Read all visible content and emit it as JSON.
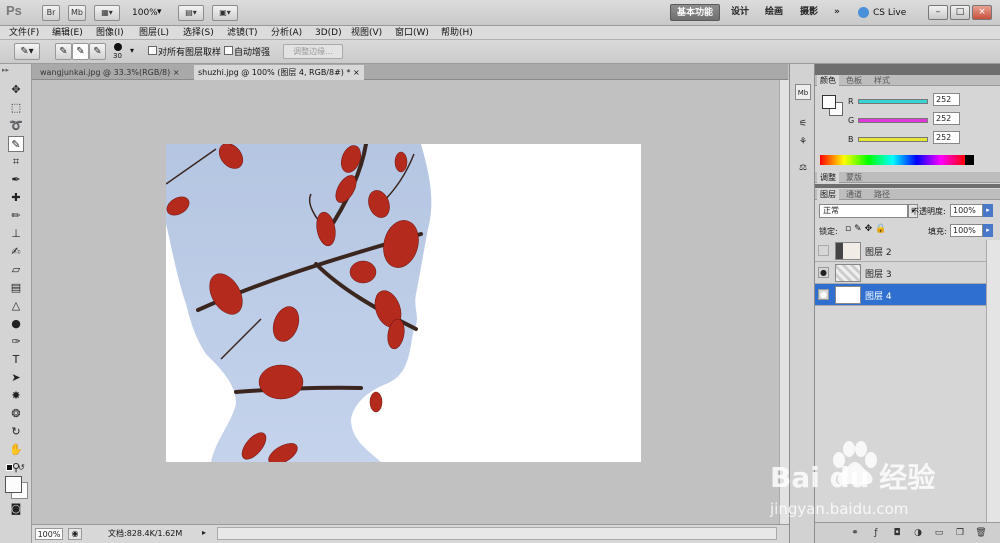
{
  "appbar": {
    "logo": "Ps",
    "app_icons": [
      "Br",
      "Mb"
    ],
    "zoom": "100%",
    "workspaces": [
      "基本功能",
      "设计",
      "绘画",
      "摄影"
    ],
    "more": "»",
    "cslive": "CS Live",
    "window_buttons": [
      "–",
      "□",
      "×"
    ]
  },
  "menu": [
    "文件(F)",
    "编辑(E)",
    "图像(I)",
    "图层(L)",
    "选择(S)",
    "滤镜(T)",
    "分析(A)",
    "3D(D)",
    "视图(V)",
    "窗口(W)",
    "帮助(H)"
  ],
  "options": {
    "brush_size": "30",
    "sample_all_layers": "对所有图层取样",
    "auto_enhance": "自动增强",
    "refine_edge": "调整边缘..."
  },
  "doc_tabs": [
    {
      "label": "wangjunkai.jpg @ 33.3%(RGB/8)",
      "close": "×"
    },
    {
      "label": "shuzhi.jpg @ 100% (图层 4, RGB/8#) *",
      "close": "×"
    }
  ],
  "status": {
    "zoom": "100%",
    "doc_info": "文档:828.4K/1.62M"
  },
  "color_panel": {
    "tabs": [
      "颜色",
      "色板",
      "样式"
    ],
    "channels": [
      {
        "name": "R",
        "value": "252",
        "color": "#37d4d4"
      },
      {
        "name": "G",
        "value": "252",
        "color": "#e038d8"
      },
      {
        "name": "B",
        "value": "252",
        "color": "#e6e635"
      }
    ]
  },
  "adjust_panel": {
    "tabs": [
      "调整",
      "蒙版"
    ]
  },
  "layers_panel": {
    "tabs": [
      "图层",
      "通道",
      "路径"
    ],
    "blend_mode": "正常",
    "opacity_label": "不透明度:",
    "opacity": "100%",
    "lock_label": "锁定:",
    "fill_label": "填充:",
    "fill": "100%",
    "layers": [
      {
        "name": "图层 2",
        "visible": false,
        "selected": false
      },
      {
        "name": "图层 3",
        "visible": true,
        "selected": false
      },
      {
        "name": "图层 4",
        "visible": true,
        "selected": true
      }
    ]
  },
  "watermark": {
    "brand": "Bai du 经验",
    "url": "jingyan.baidu.com"
  }
}
